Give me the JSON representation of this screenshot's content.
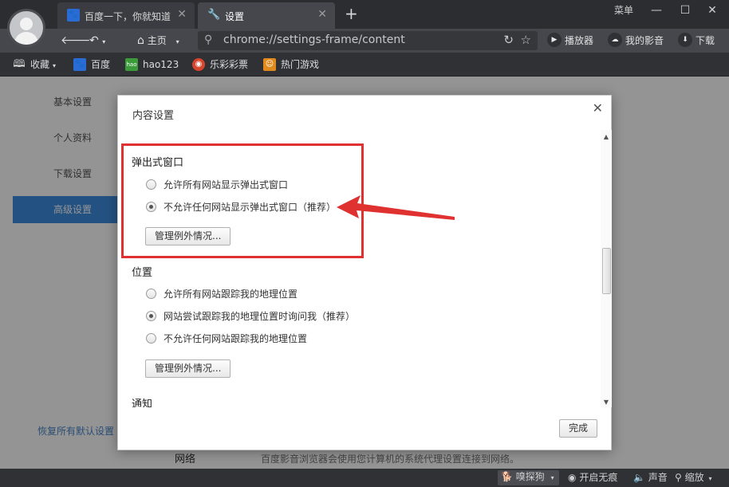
{
  "tabs": [
    {
      "label": "百度一下，你就知道",
      "icon": "baidu-paw-icon",
      "active": false
    },
    {
      "label": "设置",
      "icon": "wrench-icon",
      "active": true
    }
  ],
  "window": {
    "menu_label": "菜单",
    "min_icon": "minimize-icon",
    "max_icon": "maximize-icon",
    "close_icon": "close-icon"
  },
  "toolbar": {
    "home_label": "主页",
    "url": "chrome://settings-frame/content",
    "player_label": "播放器",
    "my_video_label": "我的影音",
    "download_label": "下载"
  },
  "bookmarks": [
    {
      "label": "收藏",
      "icon": "book-icon",
      "color": "#2f3135"
    },
    {
      "label": "百度",
      "icon": "baidu-paw-icon",
      "color": "#2b6bd6"
    },
    {
      "label": "hao123",
      "icon": "hao123-icon",
      "color": "#3b9b3b"
    },
    {
      "label": "乐彩彩票",
      "icon": "lottery-icon",
      "color": "#d8452e"
    },
    {
      "label": "热门游戏",
      "icon": "game-icon",
      "color": "#e08a1e"
    }
  ],
  "sidebar": {
    "items": [
      {
        "label": "基本设置",
        "active": false
      },
      {
        "label": "个人资料",
        "active": false
      },
      {
        "label": "下载设置",
        "active": false
      },
      {
        "label": "高级设置",
        "active": true
      }
    ],
    "restore_label": "恢复所有默认设置"
  },
  "page_bg": {
    "network_label": "网络",
    "network_desc": "百度影音浏览器会使用您计算机的系统代理设置连接到网络。"
  },
  "dialog": {
    "title": "内容设置",
    "close_icon": "close-icon",
    "popup": {
      "title": "弹出式窗口",
      "options": [
        {
          "label": "允许所有网站显示弹出式窗口",
          "checked": false
        },
        {
          "label": "不允许任何网站显示弹出式窗口（推荐）",
          "checked": true
        }
      ],
      "manage_label": "管理例外情况..."
    },
    "location": {
      "title": "位置",
      "options": [
        {
          "label": "允许所有网站跟踪我的地理位置",
          "checked": false
        },
        {
          "label": "网站尝试跟踪我的地理位置时询问我（推荐）",
          "checked": true
        },
        {
          "label": "不允许任何网站跟踪我的地理位置",
          "checked": false
        }
      ],
      "manage_label": "管理例外情况..."
    },
    "notify_title": "通知",
    "done_label": "完成"
  },
  "annotation": {
    "box_color": "#e03131",
    "arrow_color": "#e03131"
  },
  "statusbar": {
    "sniff_label": "嗅探狗",
    "private_label": "开启无痕",
    "sound_label": "声音",
    "zoom_label": "缩放"
  }
}
